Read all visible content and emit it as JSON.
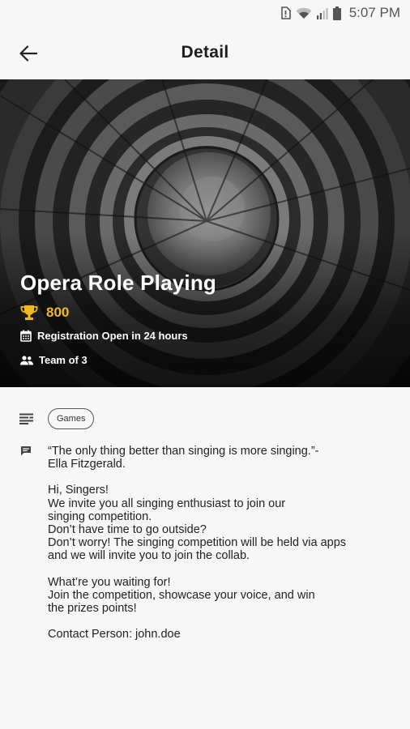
{
  "status_bar": {
    "time": "5:07 PM",
    "icons": [
      "sim-alert-icon",
      "wifi-icon",
      "signal-icon",
      "battery-icon"
    ]
  },
  "app_bar": {
    "title": "Detail",
    "back_icon": "arrow-left-icon"
  },
  "event": {
    "title": "Opera Role Playing",
    "points": "800",
    "points_icon": "trophy-icon",
    "registration": "Registration Open in 24 hours",
    "registration_icon": "calendar-icon",
    "team": "Team of 3",
    "team_icon": "people-icon",
    "accent_color": "#f2b91c"
  },
  "category": {
    "icon": "list-icon",
    "tag": "Games"
  },
  "description": {
    "icon": "comment-icon",
    "paragraphs": [
      [
        "“The only thing better than singing is more singing.”-",
        "Ella Fitzgerald."
      ],
      [
        "Hi, Singers!",
        "We invite you all singing enthusiast to join our",
        "singing competition.",
        "Don’t have time to go outside?",
        "Don’t worry! The singing competition will be held via apps",
        "and we will invite you to join the collab."
      ],
      [
        "What’re you waiting for!",
        "Join the competition, showcase your voice, and win",
        "the prizes points!"
      ],
      [
        "Contact Person: john.doe"
      ]
    ]
  }
}
